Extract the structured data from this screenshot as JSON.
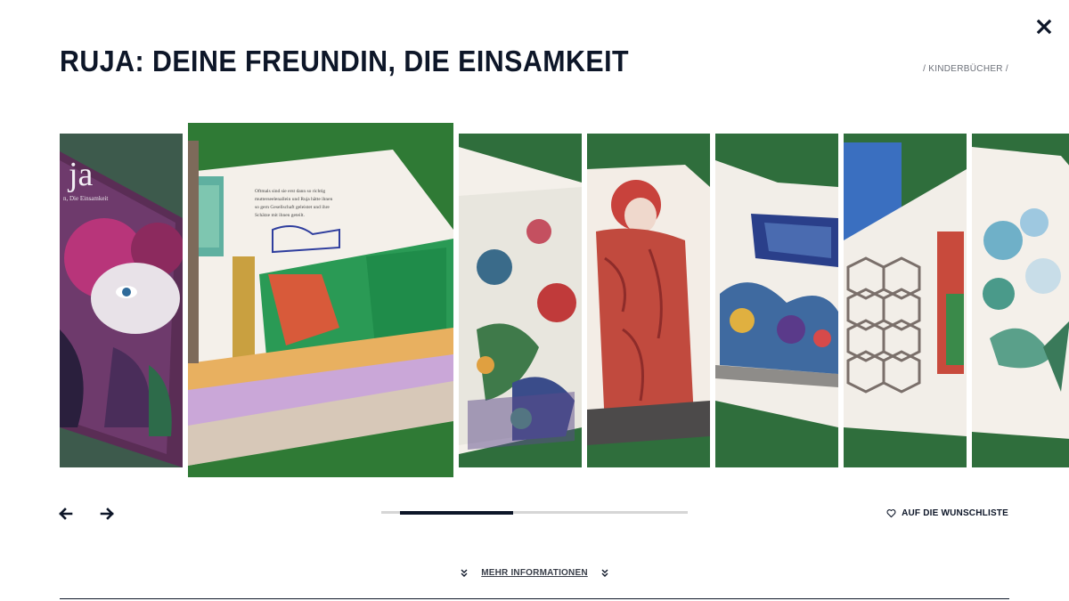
{
  "header": {
    "title": "RUJA: DEINE FREUNDIN, DIE EINSAMKEIT",
    "category": "/ KINDERBÜCHER /"
  },
  "gallery": {
    "slide_count": 8,
    "active_index": 1,
    "progress": {
      "start": 0.06,
      "end": 0.43
    },
    "cover_text": "ja",
    "cover_subtext": "n, Die Einsamkeit",
    "page_text": [
      "Oftmals sind sie erst dann so richtig",
      "mutterseelenallein und Ruja hätte ihnen",
      "so gern Gesellschaft geleistet und ihre",
      "Schätze mit ihnen geteilt."
    ]
  },
  "actions": {
    "wishlist_label": "AUF DIE WUNSCHLISTE",
    "more_info_label": "MEHR INFORMATIONEN"
  },
  "colors": {
    "navy": "#0d1628",
    "green": "#2f6e3c",
    "track": "#d6d6d6"
  }
}
